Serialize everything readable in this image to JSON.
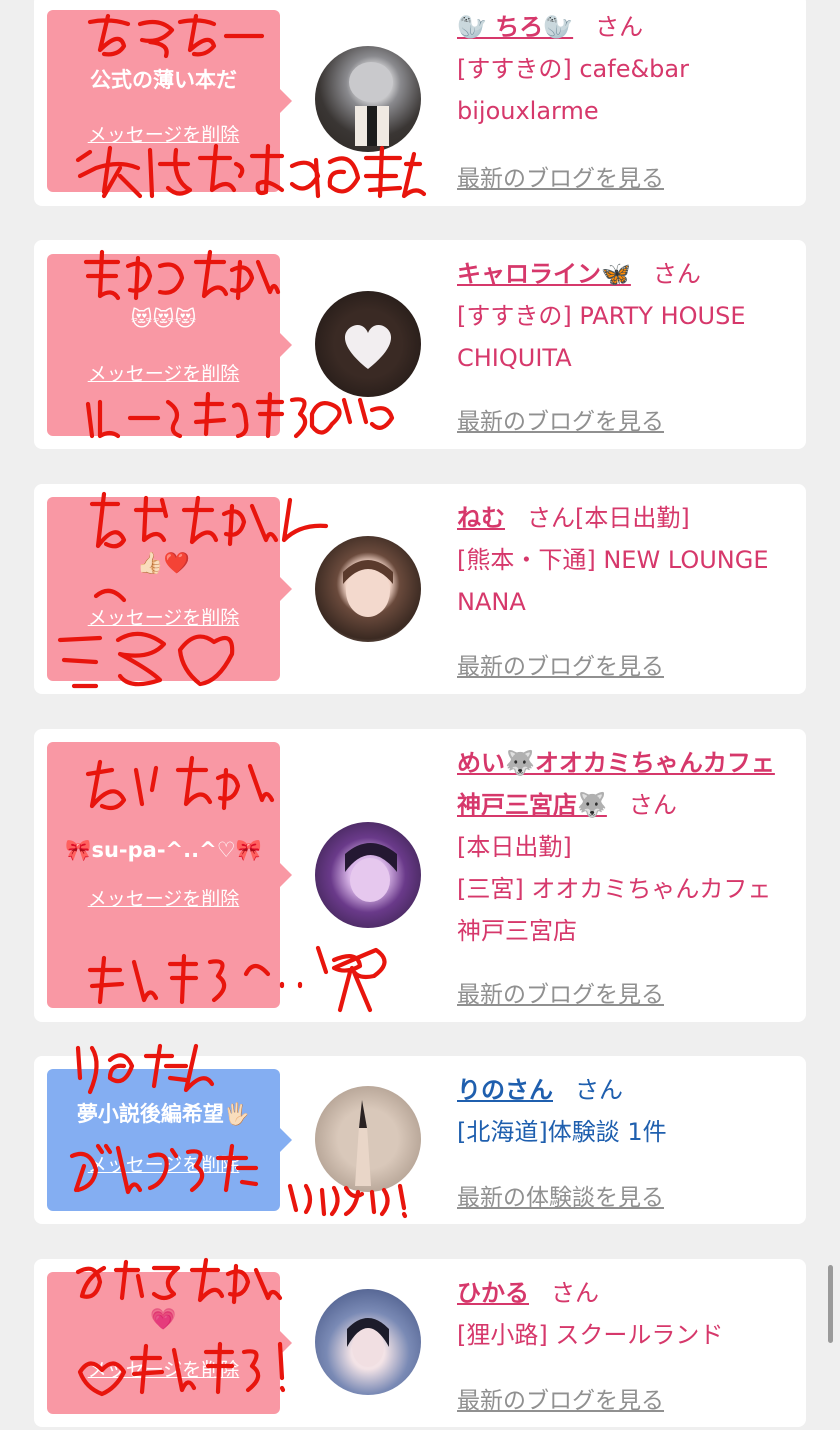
{
  "cards": [
    {
      "message": "公式の薄い本だ",
      "delete_label": "メッセージを削除",
      "name": "🦭 ちろ🦭",
      "honorific": "さん",
      "shop": "[すすきの] cafe&bar bijouxlarme",
      "link": "最新のブログを見る",
      "theme": "pink",
      "handwriting": [
        "ちろちー",
        "次はおまえの番だ"
      ]
    },
    {
      "message": "😻😻😻",
      "delete_label": "メッセージを削除",
      "name": "キャロライン🦋",
      "honorific": "さん",
      "shop": "[すすきの] PARTY HOUSE CHIQUITA",
      "link": "最新のブログを見る",
      "theme": "pink",
      "handwriting": [
        "きゃろちゃん",
        "はーとせんきう♡"
      ]
    },
    {
      "message": "👍🏻❤️",
      "delete_label": "メッセージを削除",
      "name": "ねむ",
      "honorific": "さん[本日出勤]",
      "shop": "[熊本・下通] NEW LOUNGE NANA",
      "link": "最新のブログを見る",
      "theme": "pink",
      "handwriting": [
        "ねむちゃん",
        "^ ─ ♡"
      ]
    },
    {
      "message": "🎀su-pa-^..^♡🎀",
      "delete_label": "メッセージを削除",
      "name": "めい🐺オオカミちゃんカフェ神戸三宮店🐺",
      "honorific": "さん",
      "status": "[本日出勤]",
      "shop": "[三宮] オオカミちゃんカフェ神戸三宮店",
      "link": "最新のブログを見る",
      "theme": "pink",
      "handwriting": [
        "めいちゃん",
        "せんきう^..^🎀"
      ]
    },
    {
      "message": "夢小説後編希望🖐🏻",
      "delete_label": "メッセージを削除",
      "name": "りのさん",
      "honorific": "さん",
      "shop": "[北海道]体験談 1件",
      "link": "最新の体験談を見る",
      "theme": "blue",
      "handwriting": [
        "りのたん",
        "ぶんごうたいりょい!"
      ]
    },
    {
      "message": "💗",
      "delete_label": "メッセージを削除",
      "name": "ひかる",
      "honorific": "さん",
      "shop": "[狸小路] スクールランド",
      "link": "最新のブログを見る",
      "theme": "pink",
      "handwriting": [
        "ひかるちゃん",
        "♡せんきう!"
      ]
    }
  ],
  "colors": {
    "pink_bubble": "#f998a4",
    "blue_bubble": "#84aef2",
    "pink_text": "#d6386b",
    "blue_text": "#1f5fae",
    "scribble": "#e8150d"
  }
}
